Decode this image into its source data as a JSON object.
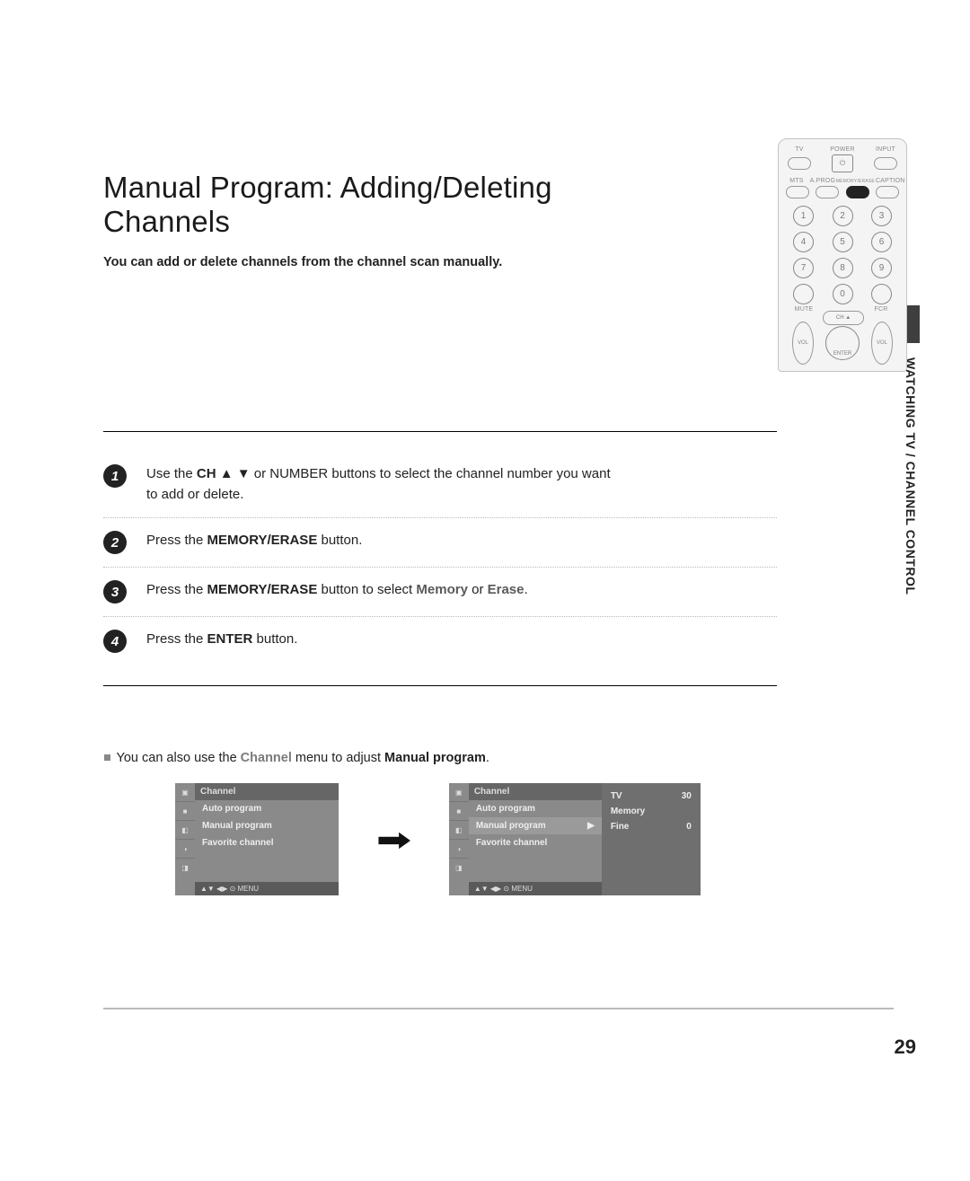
{
  "sideLabel": "WATCHING TV / CHANNEL CONTROL",
  "pageNumber": "29",
  "title": "Manual Program: Adding/Deleting Channels",
  "subtitle": "You can add or delete channels from the channel scan manually.",
  "remote": {
    "row1": {
      "left": "TV",
      "center": "POWER",
      "right": "INPUT",
      "powerGlyph": "⏻"
    },
    "row2": {
      "a": "MTS",
      "b": "A.PROG",
      "c": "MEMORY/ERASE",
      "d": "CAPTION"
    },
    "keypad": [
      [
        "1",
        "2",
        "3"
      ],
      [
        "4",
        "5",
        "6"
      ],
      [
        "7",
        "8",
        "9"
      ]
    ],
    "muteLabel": "MUTE",
    "zero": "0",
    "fcrLabel": "FCR",
    "chLabel": "CH ▲",
    "enter": "ENTER",
    "volLabel": "VOL"
  },
  "steps": [
    {
      "n": "1",
      "pre": "Use the ",
      "k1": "CH ▲ ▼",
      "mid": " or NUMBER buttons to select the channel number you want to add or delete."
    },
    {
      "n": "2",
      "pre": "Press the ",
      "k1": "MEMORY/ERASE",
      "mid": " button."
    },
    {
      "n": "3",
      "pre": "Press the ",
      "k1": "MEMORY/ERASE",
      "mid": " button to select ",
      "k2": "Memory",
      "mid2": " or ",
      "k3": "Erase",
      "mid3": "."
    },
    {
      "n": "4",
      "pre": "Press the ",
      "k1": "ENTER",
      "mid": " button."
    }
  ],
  "note": {
    "lead": "■",
    "a": " You can also use the ",
    "menuLabel": "Channel",
    "b": " menu to adjust ",
    "bold": "Manual program",
    "c": "."
  },
  "menu": {
    "title": "Channel",
    "items": [
      "Auto program",
      "Manual program",
      "Favorite channel"
    ],
    "footer": "▲▼  ◀▶  ⊙  MENU",
    "arrow": "▶",
    "detail": [
      [
        "TV",
        "30"
      ],
      [
        "Memory",
        ""
      ],
      [
        "Fine",
        "0"
      ]
    ],
    "iconGlyphs": [
      "▣",
      "■",
      "◧",
      "◑",
      "◨"
    ]
  }
}
